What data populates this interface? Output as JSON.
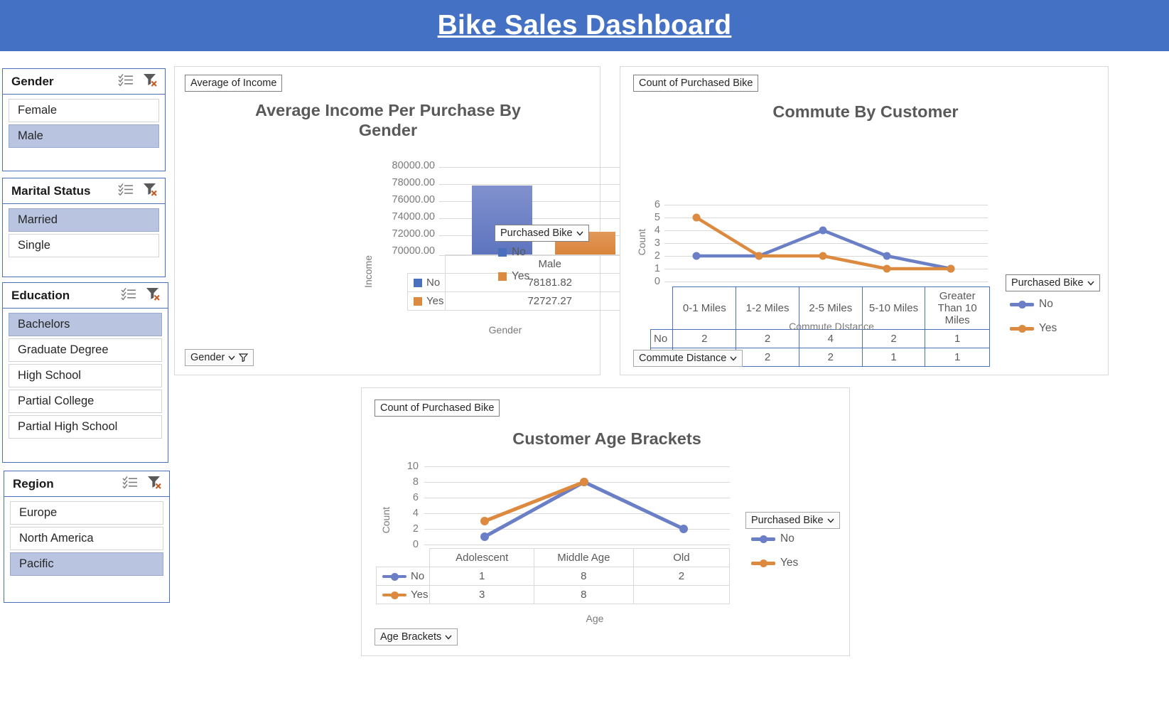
{
  "banner": {
    "title": "Bike Sales Dashboard",
    "bg_color": "#4471c4",
    "text_color": "#ffffff"
  },
  "colors": {
    "series_no": "#6b7fc7",
    "series_yes": "#dd8a41",
    "slicer_border": "#4a6fbd",
    "slicer_selected": "#b8c4e0"
  },
  "slicers": [
    {
      "title": "Gender",
      "multiselect_icon": "multi-select-icon",
      "clear_icon": "clear-filter-icon",
      "items": [
        {
          "label": "Female",
          "selected": false
        },
        {
          "label": "Male",
          "selected": true
        }
      ]
    },
    {
      "title": "Marital Status",
      "multiselect_icon": "multi-select-icon",
      "clear_icon": "clear-filter-icon",
      "items": [
        {
          "label": "Married",
          "selected": true
        },
        {
          "label": "Single",
          "selected": false
        }
      ]
    },
    {
      "title": "Education",
      "multiselect_icon": "multi-select-icon",
      "clear_icon": "clear-filter-icon",
      "items": [
        {
          "label": "Bachelors",
          "selected": true
        },
        {
          "label": "Graduate Degree",
          "selected": false
        },
        {
          "label": "High School",
          "selected": false
        },
        {
          "label": "Partial College",
          "selected": false
        },
        {
          "label": "Partial High School",
          "selected": false
        }
      ]
    },
    {
      "title": "Region",
      "multiselect_icon": "multi-select-icon",
      "clear_icon": "clear-filter-icon",
      "items": [
        {
          "label": "Europe",
          "selected": false
        },
        {
          "label": "North America",
          "selected": false
        },
        {
          "label": "Pacific",
          "selected": true
        }
      ]
    }
  ],
  "panels": {
    "income": {
      "value_field_button": "Average of Income",
      "axis_field_button": "Gender",
      "legend_field_button": "Purchased Bike"
    },
    "commute": {
      "value_field_button": "Count of Purchased Bike",
      "axis_field_button": "Commute Distance",
      "legend_field_button": "Purchased Bike"
    },
    "age": {
      "value_field_button": "Count of Purchased Bike",
      "axis_field_button": "Age Brackets",
      "legend_field_button": "Purchased Bike"
    }
  },
  "chart_data": [
    {
      "id": "income-by-gender",
      "type": "bar",
      "title": "Average Income Per Purchase By Gender",
      "xlabel": "Gender",
      "ylabel": "Income",
      "categories": [
        "Male"
      ],
      "ylim": [
        70000,
        80000
      ],
      "yticks": [
        "70000.00",
        "72000.00",
        "74000.00",
        "76000.00",
        "78000.00",
        "80000.00"
      ],
      "legend_title": "Purchased Bike",
      "legend_position": "right",
      "grid": true,
      "series": [
        {
          "name": "No",
          "color": "#6b7fc7",
          "values": [
            78181.82
          ],
          "labels": [
            "78181.82"
          ]
        },
        {
          "name": "Yes",
          "color": "#dd8a41",
          "values": [
            72727.27
          ],
          "labels": [
            "72727.27"
          ]
        }
      ],
      "data_table": {
        "header": [
          "Male"
        ],
        "rows": [
          {
            "name": "No",
            "cells": [
              "78181.82"
            ]
          },
          {
            "name": "Yes",
            "cells": [
              "72727.27"
            ]
          }
        ]
      }
    },
    {
      "id": "commute-by-customer",
      "type": "line",
      "title": "Commute By Customer",
      "xlabel": "Commute DIstance",
      "ylabel": "Count",
      "categories": [
        "0-1 Miles",
        "1-2 Miles",
        "2-5 Miles",
        "5-10 Miles",
        "Greater Than 10 Miles"
      ],
      "ylim": [
        0,
        6
      ],
      "yticks": [
        "0",
        "1",
        "2",
        "3",
        "4",
        "5",
        "6"
      ],
      "legend_title": "Purchased Bike",
      "legend_position": "right",
      "grid": true,
      "series": [
        {
          "name": "No",
          "color": "#6b7fc7",
          "values": [
            2,
            2,
            4,
            2,
            1
          ]
        },
        {
          "name": "Yes",
          "color": "#dd8a41",
          "values": [
            5,
            2,
            2,
            1,
            1
          ]
        }
      ],
      "data_table": {
        "header": [
          "0-1 Miles",
          "1-2 Miles",
          "2-5 Miles",
          "5-10 Miles",
          "Greater Than 10 Miles"
        ],
        "rows": [
          {
            "name": "No",
            "cells": [
              "2",
              "2",
              "4",
              "2",
              "1"
            ]
          },
          {
            "name": "Yes",
            "cells": [
              "5",
              "2",
              "2",
              "1",
              "1"
            ]
          }
        ]
      }
    },
    {
      "id": "customer-age-brackets",
      "type": "line",
      "title": "Customer Age Brackets",
      "xlabel": "Age",
      "ylabel": "Count",
      "categories": [
        "Adolescent",
        "Middle Age",
        "Old"
      ],
      "ylim": [
        0,
        10
      ],
      "yticks": [
        "0",
        "2",
        "4",
        "6",
        "8",
        "10"
      ],
      "legend_title": "Purchased Bike",
      "legend_position": "right",
      "grid": true,
      "series": [
        {
          "name": "No",
          "color": "#6b7fc7",
          "values": [
            1,
            8,
            2
          ]
        },
        {
          "name": "Yes",
          "color": "#dd8a41",
          "values": [
            3,
            8,
            null
          ]
        }
      ],
      "data_table": {
        "header": [
          "Adolescent",
          "Middle Age",
          "Old"
        ],
        "rows": [
          {
            "name": "No",
            "cells": [
              "1",
              "8",
              "2"
            ]
          },
          {
            "name": "Yes",
            "cells": [
              "3",
              "8",
              ""
            ]
          }
        ]
      }
    }
  ]
}
